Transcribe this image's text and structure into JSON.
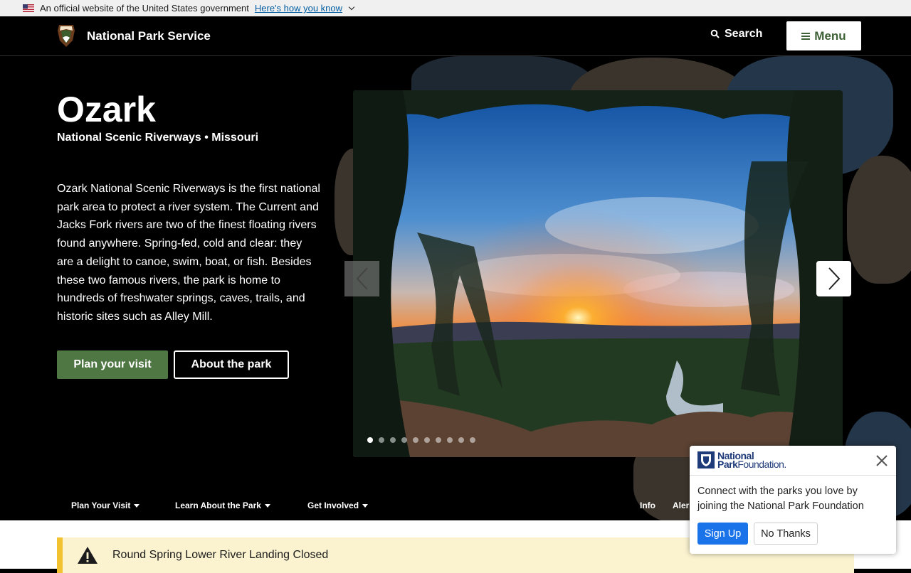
{
  "gov_banner": {
    "text": "An official website of the United States government",
    "link": "Here's how you know"
  },
  "header": {
    "site_name": "National Park Service",
    "search_label": "Search",
    "menu_label": "Menu"
  },
  "hero": {
    "title": "Ozark",
    "subtitle": "National Scenic Riverways • Missouri",
    "description": "Ozark National Scenic Riverways is the first national park area to protect a river system. The Current and Jacks Fork rivers are two of the finest floating rivers found anywhere. Spring-fed, cold and clear: they are a delight to canoe, swim, boat, or fish. Besides these two famous rivers, the park is home to hundreds of freshwater springs, caves, trails, and historic sites such as Alley Mill.",
    "primary_button": "Plan your visit",
    "secondary_button": "About the park",
    "carousel": {
      "slide_count": 10,
      "active_index": 0
    }
  },
  "park_nav": {
    "items": [
      "Plan Your Visit",
      "Learn About the Park",
      "Get Involved"
    ],
    "right_items": [
      "Info",
      "Aler"
    ]
  },
  "alert": {
    "text": "Round Spring Lower River Landing Closed"
  },
  "npf_popup": {
    "logo_line1": "National",
    "logo_line2a": "Park",
    "logo_line2b": "Foundation.",
    "message": "Connect with the parks you love by joining the National Park Foundation",
    "signup": "Sign Up",
    "no_thanks": "No Thanks"
  },
  "colors": {
    "primary_green": "#4f7743",
    "menu_green": "#3f6137",
    "link_blue": "#005ea2",
    "alert_bg": "#fbf3d0",
    "alert_border": "#f2c230",
    "signup_blue": "#1a73e8"
  }
}
